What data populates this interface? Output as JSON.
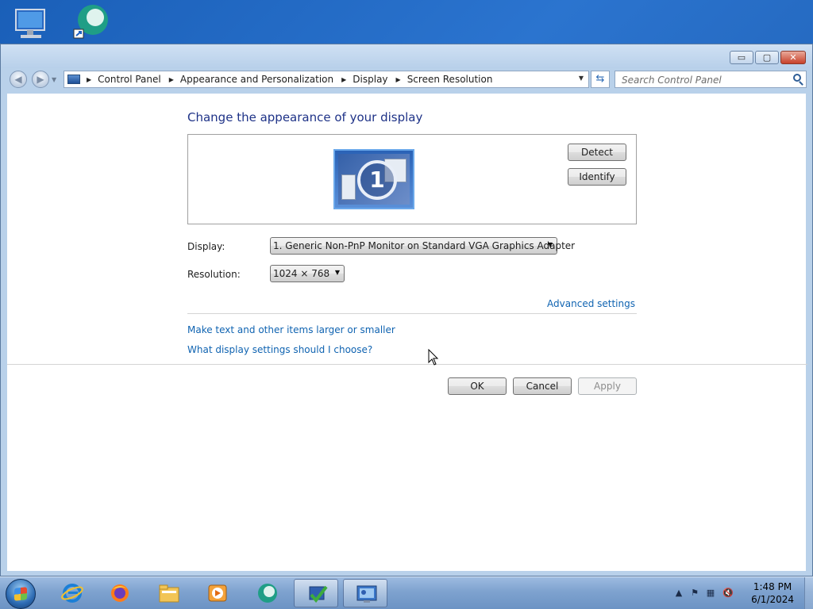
{
  "window": {
    "controls": {
      "minimize": "▭",
      "maximize": "▢",
      "close": "✕"
    }
  },
  "address": {
    "breadcrumb": [
      "Control Panel",
      "Appearance and Personalization",
      "Display",
      "Screen Resolution"
    ],
    "search_placeholder": "Search Control Panel"
  },
  "main": {
    "heading": "Change the appearance of your display",
    "monitor_number": "1",
    "detect_label": "Detect",
    "identify_label": "Identify",
    "display_label": "Display:",
    "display_value": "1. Generic Non-PnP Monitor on Standard VGA Graphics Adapter",
    "resolution_label": "Resolution:",
    "resolution_value": "1024 × 768",
    "advanced_link": "Advanced settings",
    "link_text_size": "Make text and other items larger or smaller",
    "link_help": "What display settings should I choose?",
    "ok_label": "OK",
    "cancel_label": "Cancel",
    "apply_label": "Apply"
  },
  "taskbar": {
    "time": "1:48 PM",
    "date": "6/1/2024",
    "tray_chevron": "▲"
  },
  "colors": {
    "heading": "#1e3287",
    "link": "#0f63b1",
    "desktop": "#1a5fb8"
  }
}
